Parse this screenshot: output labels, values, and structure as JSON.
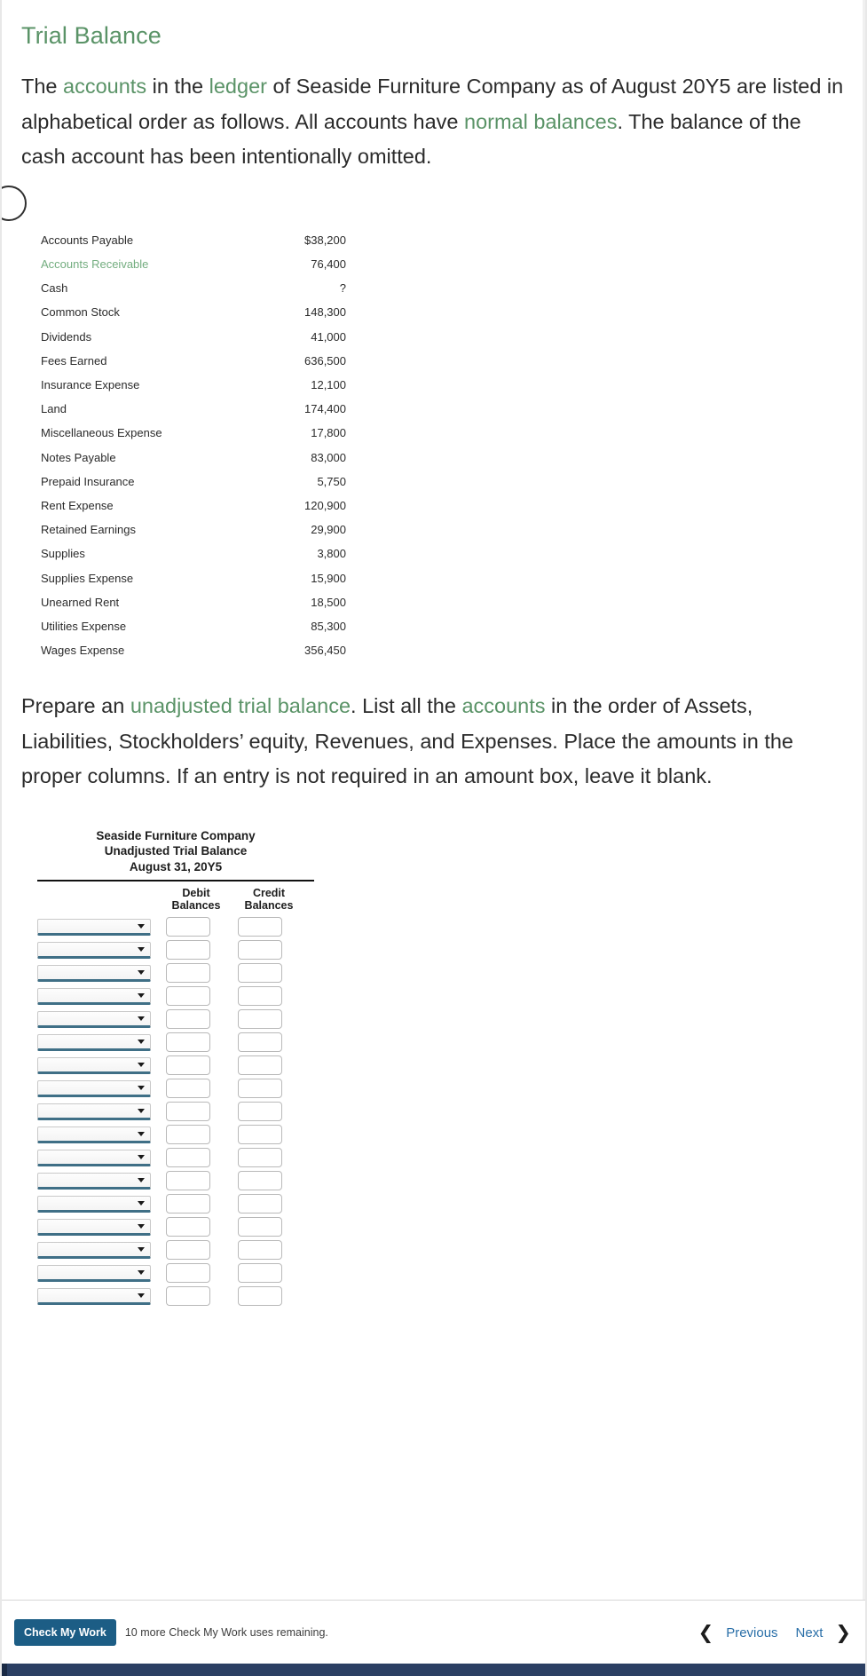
{
  "section": {
    "title": "Trial Balance",
    "intro_parts": [
      {
        "text": "The ",
        "term": false
      },
      {
        "text": "accounts",
        "term": true
      },
      {
        "text": " in the ",
        "term": false
      },
      {
        "text": "ledger",
        "term": true
      },
      {
        "text": " of Seaside Furniture Company as of August 20Y5 are listed in alphabetical order as follows. All accounts have ",
        "term": false
      },
      {
        "text": "normal balances",
        "term": true
      },
      {
        "text": ". The balance of the cash account has been intentionally omitted.",
        "term": false
      }
    ],
    "instruction_parts": [
      {
        "text": "Prepare an ",
        "term": false
      },
      {
        "text": "unadjusted trial balance",
        "term": true
      },
      {
        "text": ". List all the ",
        "term": false
      },
      {
        "text": "accounts",
        "term": true
      },
      {
        "text": " in the order of Assets, Liabilities, Stockholders’ equity, Revenues, and Expenses. Place the amounts in the proper columns. If an entry is not required in an amount box, leave it blank.",
        "term": false
      }
    ]
  },
  "given_accounts": {
    "rows": [
      {
        "name": "Accounts Payable",
        "amount": "$38,200",
        "highlight": false
      },
      {
        "name": "Accounts Receivable",
        "amount": "76,400",
        "highlight": true
      },
      {
        "name": "Cash",
        "amount": "?",
        "highlight": false
      },
      {
        "name": "Common Stock",
        "amount": "148,300",
        "highlight": false
      },
      {
        "name": "Dividends",
        "amount": "41,000",
        "highlight": false
      },
      {
        "name": "Fees Earned",
        "amount": "636,500",
        "highlight": false
      },
      {
        "name": "Insurance Expense",
        "amount": "12,100",
        "highlight": false
      },
      {
        "name": "Land",
        "amount": "174,400",
        "highlight": false
      },
      {
        "name": "Miscellaneous Expense",
        "amount": "17,800",
        "highlight": false
      },
      {
        "name": "Notes Payable",
        "amount": "83,000",
        "highlight": false
      },
      {
        "name": "Prepaid Insurance",
        "amount": "5,750",
        "highlight": false
      },
      {
        "name": "Rent Expense",
        "amount": "120,900",
        "highlight": false
      },
      {
        "name": "Retained Earnings",
        "amount": "29,900",
        "highlight": false
      },
      {
        "name": "Supplies",
        "amount": "3,800",
        "highlight": false
      },
      {
        "name": "Supplies Expense",
        "amount": "15,900",
        "highlight": false
      },
      {
        "name": "Unearned Rent",
        "amount": "18,500",
        "highlight": false
      },
      {
        "name": "Utilities Expense",
        "amount": "85,300",
        "highlight": false
      },
      {
        "name": "Wages Expense",
        "amount": "356,450",
        "highlight": false
      }
    ]
  },
  "trial_balance_form": {
    "company": "Seaside Furniture Company",
    "statement": "Unadjusted Trial Balance",
    "date": "August 31, 20Y5",
    "col_debit": "Debit Balances",
    "col_credit": "Credit Balances",
    "row_count": 17,
    "account_select_value": "",
    "debit_value": "",
    "credit_value": ""
  },
  "bottom_bar": {
    "check_my_work_label": "Check My Work",
    "uses_remaining": "10 more Check My Work uses remaining.",
    "previous_label": "Previous",
    "next_label": "Next",
    "prev_chevron": "❮",
    "next_chevron": "❯"
  },
  "colors": {
    "accent_green": "#5a9367",
    "link_blue": "#2a6fa8",
    "button_blue": "#1c5d85",
    "select_underline": "#3f6f86",
    "footer": "#2b3f63"
  }
}
